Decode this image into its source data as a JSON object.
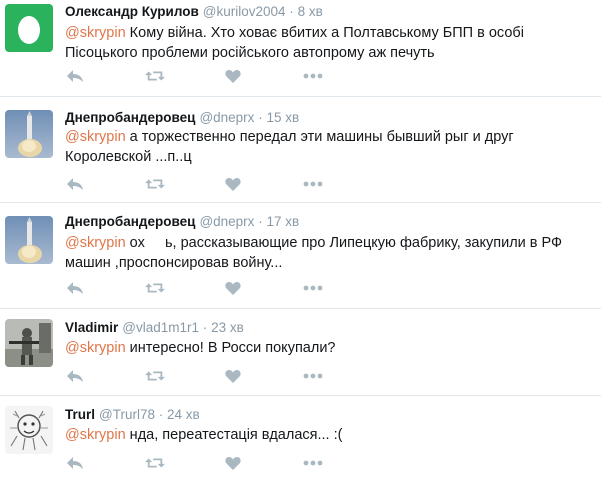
{
  "tweets": [
    {
      "name": "Олександр Курилов",
      "handle": "@kurilov2004",
      "time": "8 хв",
      "mention": "@skrypin",
      "text": " Кому війна.  Хто ховає вбитих а Полтавському БПП в особі Пісоцького проблеми російського автопрому аж печуть",
      "avatar_icon": "egg-icon"
    },
    {
      "name": "Днепробандеровец",
      "handle": "@dneprx",
      "time": "15 хв",
      "mention": "@skrypin",
      "text": " а торжественно передал эти машины бывший рыг и друг Королевской ...п..ц",
      "avatar_icon": "rocket-launch-icon"
    },
    {
      "name": "Днепробандеровец",
      "handle": "@dneprx",
      "time": "17 хв",
      "mention": "@skrypin",
      "text": " ох     ь, рассказывающие про Липецкую фабрику, закупили в РФ машин ,проспонсировав войну...",
      "avatar_icon": "rocket-launch-icon"
    },
    {
      "name": "Vladimir",
      "handle": "@vlad1m1r1",
      "time": "23 хв",
      "mention": "@skrypin",
      "text": " интересно! В Росси покупали?",
      "avatar_icon": "soldier-photo-icon"
    },
    {
      "name": "Trurl",
      "handle": "@Trurl78",
      "time": "24 хв",
      "mention": "@skrypin",
      "text": " нда, переатестація вдалася... :(",
      "avatar_icon": "sketch-avatar-icon"
    }
  ],
  "separator": "·",
  "actions": [
    "reply-icon",
    "retweet-icon",
    "like-icon",
    "more-icon"
  ],
  "colors": {
    "mention": "#e0764a",
    "muted": "#8899a6",
    "action": "#aab8c2",
    "egg_bg": "#2ab25c",
    "divider": "#e1e8ed"
  }
}
